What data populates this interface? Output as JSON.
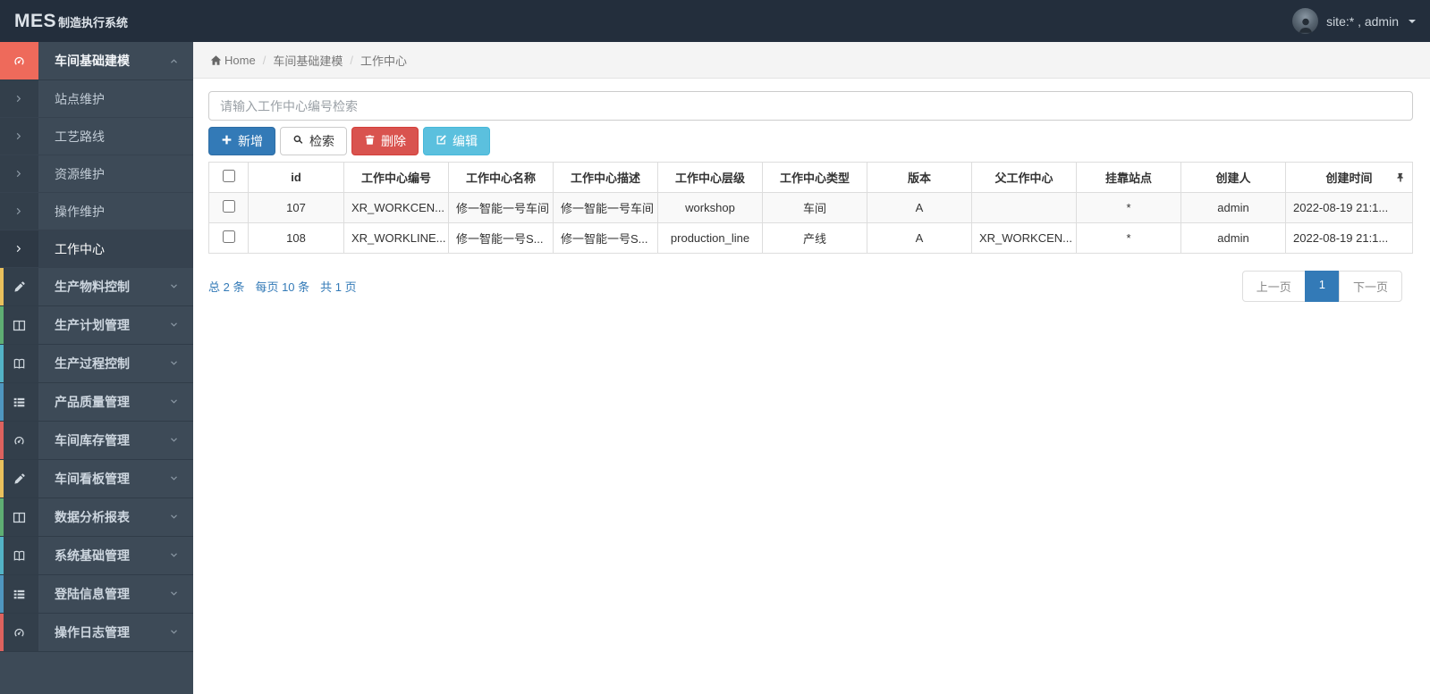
{
  "navbar": {
    "brand_bold": "MES",
    "brand_rest": "制造执行系统",
    "user_label": "site:* , admin"
  },
  "sidebar": {
    "active_group": {
      "label": "车间基础建模",
      "icon": "dashboard-icon",
      "icon_bg": "#ee6a5b"
    },
    "sub_items": [
      {
        "label": "站点维护",
        "active": false
      },
      {
        "label": "工艺路线",
        "active": false
      },
      {
        "label": "资源维护",
        "active": false
      },
      {
        "label": "操作维护",
        "active": false
      },
      {
        "label": "工作中心",
        "active": true
      }
    ],
    "groups": [
      {
        "label": "生产物料控制",
        "icon": "pencil-icon",
        "accent": "#e9c05c"
      },
      {
        "label": "生产计划管理",
        "icon": "columns-icon",
        "accent": "#5fae73"
      },
      {
        "label": "生产过程控制",
        "icon": "book-icon",
        "accent": "#53b3c6"
      },
      {
        "label": "产品质量管理",
        "icon": "list-icon",
        "accent": "#4f96bf"
      },
      {
        "label": "车间库存管理",
        "icon": "dashboard-icon",
        "accent": "#dd625e"
      },
      {
        "label": "车间看板管理",
        "icon": "pencil-icon",
        "accent": "#e9c05c"
      },
      {
        "label": "数据分析报表",
        "icon": "columns-icon",
        "accent": "#5fae73"
      },
      {
        "label": "系统基础管理",
        "icon": "book-icon",
        "accent": "#53b3c6"
      },
      {
        "label": "登陆信息管理",
        "icon": "list-icon",
        "accent": "#4f96bf"
      },
      {
        "label": "操作日志管理",
        "icon": "dashboard-icon",
        "accent": "#dd625e"
      }
    ]
  },
  "breadcrumb": {
    "items": [
      "Home",
      "车间基础建模",
      "工作中心"
    ]
  },
  "search": {
    "placeholder": "请输入工作中心编号检索"
  },
  "toolbar": {
    "buttons": [
      {
        "label": "新增",
        "style": "primary",
        "icon": "plus-icon",
        "name": "add-button"
      },
      {
        "label": "检索",
        "style": "default",
        "icon": "search-icon",
        "name": "search-button"
      },
      {
        "label": "删除",
        "style": "danger",
        "icon": "trash-icon",
        "name": "delete-button"
      },
      {
        "label": "编辑",
        "style": "info",
        "icon": "edit-icon",
        "name": "edit-button"
      }
    ]
  },
  "table": {
    "headers": [
      "id",
      "工作中心编号",
      "工作中心名称",
      "工作中心描述",
      "工作中心层级",
      "工作中心类型",
      "版本",
      "父工作中心",
      "挂靠站点",
      "创建人",
      "创建时间"
    ],
    "rows": [
      [
        "107",
        "XR_WORKCEN...",
        "修一智能一号车间",
        "修一智能一号车间",
        "workshop",
        "车间",
        "A",
        "",
        "*",
        "admin",
        "2022-08-19 21:1..."
      ],
      [
        "108",
        "XR_WORKLINE...",
        "修一智能一号S...",
        "修一智能一号S...",
        "production_line",
        "产线",
        "A",
        "XR_WORKCEN...",
        "*",
        "admin",
        "2022-08-19 21:1..."
      ]
    ]
  },
  "pagination": {
    "total": "总 2 条",
    "per_page": "每页 10 条",
    "pages": "共 1 页",
    "prev": "上一页",
    "current": "1",
    "next": "下一页"
  },
  "colors": {
    "primary": "#337ab7",
    "danger": "#d9534f",
    "info": "#5bc0de",
    "sidebar_active_icon_bg": "#ee6a5b",
    "navbar_bg": "#232e3c",
    "sidebar_bg": "#3d4a57"
  }
}
